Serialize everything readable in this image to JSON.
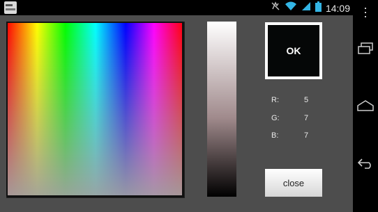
{
  "status_bar": {
    "time": "14:09",
    "icons": [
      "app-icon",
      "mute-icon",
      "wifi-icon",
      "signal-icon",
      "battery-icon"
    ]
  },
  "color_picker": {
    "ok_label": "OK",
    "preview_color": "#050707",
    "r_label": "R:",
    "r_value": "5",
    "g_label": "G:",
    "g_value": "7",
    "b_label": "B:",
    "b_value": "7",
    "close_label": "close"
  },
  "nav_bar": {
    "icons": [
      "menu-icon",
      "recent-apps-icon",
      "home-icon",
      "back-icon"
    ]
  }
}
